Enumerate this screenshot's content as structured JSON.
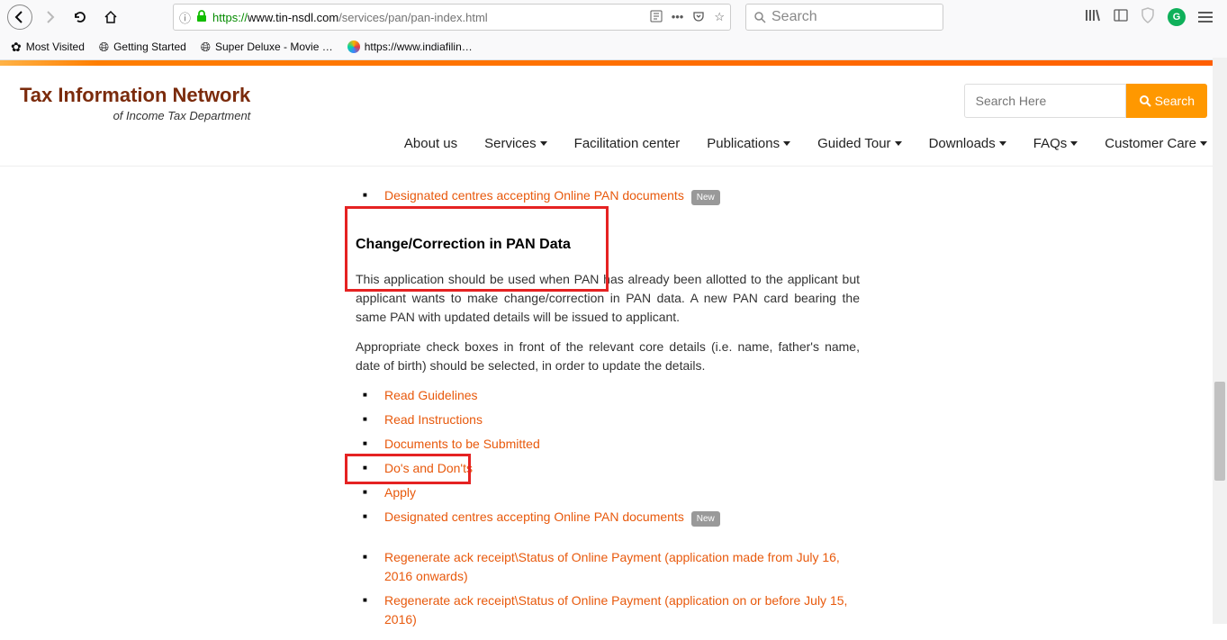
{
  "browser": {
    "url_protocol": "https://",
    "url_domain": "www.tin-nsdl.com",
    "url_path": "/services/pan/pan-index.html",
    "search_placeholder": "Search",
    "bookmarks": [
      {
        "icon": "✿",
        "label": "Most Visited"
      },
      {
        "icon": "globe",
        "label": "Getting Started"
      },
      {
        "icon": "globe",
        "label": "Super Deluxe - Movie …"
      },
      {
        "icon": "swirl",
        "label": "https://www.indiafilin…"
      }
    ]
  },
  "site": {
    "title": "Tax Information Network",
    "subtitle": "of Income Tax Department",
    "search_placeholder": "Search Here",
    "search_button": "Search",
    "nav": [
      {
        "label": "About us",
        "dropdown": false
      },
      {
        "label": "Services",
        "dropdown": true
      },
      {
        "label": "Facilitation center",
        "dropdown": false
      },
      {
        "label": "Publications",
        "dropdown": true
      },
      {
        "label": "Guided Tour",
        "dropdown": true
      },
      {
        "label": "Downloads",
        "dropdown": true
      },
      {
        "label": "FAQs",
        "dropdown": true
      },
      {
        "label": "Customer Care",
        "dropdown": true
      }
    ]
  },
  "content": {
    "top_link": {
      "label": "Designated centres accepting Online PAN documents",
      "badge": "New"
    },
    "heading": "Change/Correction in PAN Data",
    "para1": "This application should be used when PAN has already been allotted to the applicant but applicant wants to make change/correction in PAN data. A new PAN card bearing the same PAN with updated details will be issued to applicant.",
    "para2": "Appropriate check boxes in front of the relevant core details (i.e. name, father's name, date of birth) should be selected, in order to update the details.",
    "links": [
      {
        "label": "Read Guidelines"
      },
      {
        "label": "Read Instructions"
      },
      {
        "label": "Documents to be Submitted"
      },
      {
        "label": "Do's and Don'ts"
      },
      {
        "label": "Apply"
      },
      {
        "label": "Designated centres accepting Online PAN documents",
        "badge": "New"
      }
    ],
    "links2": [
      {
        "label": "Regenerate ack receipt\\Status of Online Payment (application made from July 16, 2016 onwards)"
      },
      {
        "label": "Regenerate ack receipt\\Status of Online Payment (application on or before July 15, 2016)"
      }
    ]
  }
}
